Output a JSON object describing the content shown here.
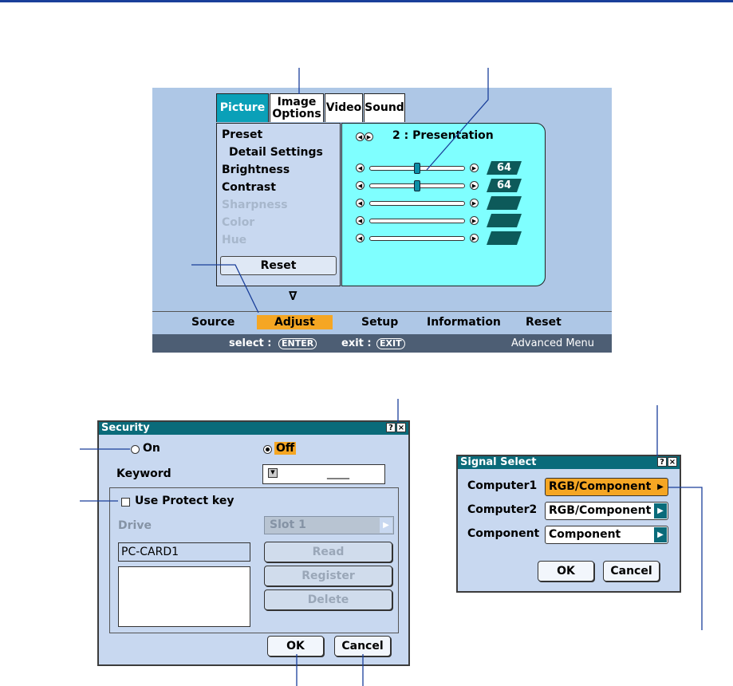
{
  "main_menu": {
    "tabs": [
      {
        "label": "Picture"
      },
      {
        "label": "Image Options"
      },
      {
        "label": "Video"
      },
      {
        "label": "Sound"
      }
    ],
    "items": [
      {
        "label": "Preset",
        "enabled": true
      },
      {
        "label": "Detail Settings",
        "enabled": true
      },
      {
        "label": "Brightness",
        "enabled": true
      },
      {
        "label": "Contrast",
        "enabled": true
      },
      {
        "label": "Sharpness",
        "enabled": false
      },
      {
        "label": "Color",
        "enabled": false
      },
      {
        "label": "Hue",
        "enabled": false
      }
    ],
    "reset_label": "Reset",
    "preset_value": "2 : Presentation",
    "sliders": [
      {
        "value": "64",
        "level": 0.5,
        "enabled": true
      },
      {
        "value": "64",
        "level": 0.5,
        "enabled": true
      },
      {
        "value": "",
        "enabled": false
      },
      {
        "value": "",
        "enabled": false
      },
      {
        "value": "",
        "enabled": false
      }
    ],
    "more_indicator": "∇",
    "bottom_items": [
      "Source",
      "Adjust",
      "Setup",
      "Information",
      "Reset"
    ],
    "active_bottom": "Adjust",
    "status": {
      "select_label": "select :",
      "select_key": "ENTER",
      "exit_label": "exit :",
      "exit_key": "EXIT",
      "mode": "Advanced Menu"
    }
  },
  "security_dialog": {
    "title": "Security",
    "help_icon": "?",
    "close_icon": "×",
    "on_label": "On",
    "off_label": "Off",
    "selected": "Off",
    "keyword_label": "Keyword",
    "keyword_value": "____",
    "protect_label": "Use Protect key",
    "drive_label": "Drive",
    "drive_value": "Slot 1",
    "card_name": "PC-CARD1",
    "read_label": "Read",
    "register_label": "Register",
    "delete_label": "Delete",
    "ok_label": "OK",
    "cancel_label": "Cancel"
  },
  "signal_dialog": {
    "title": "Signal Select",
    "help_icon": "?",
    "close_icon": "×",
    "rows": [
      {
        "label": "Computer1",
        "value": "RGB/Component"
      },
      {
        "label": "Computer2",
        "value": "RGB/Component"
      },
      {
        "label": "Component",
        "value": "Component"
      }
    ],
    "ok_label": "OK",
    "cancel_label": "Cancel"
  },
  "colors": {
    "accent": "#f5a623",
    "active_tab": "#0aa0b8",
    "panel": "#7fffff",
    "title_bar": "#0a6b7a"
  }
}
